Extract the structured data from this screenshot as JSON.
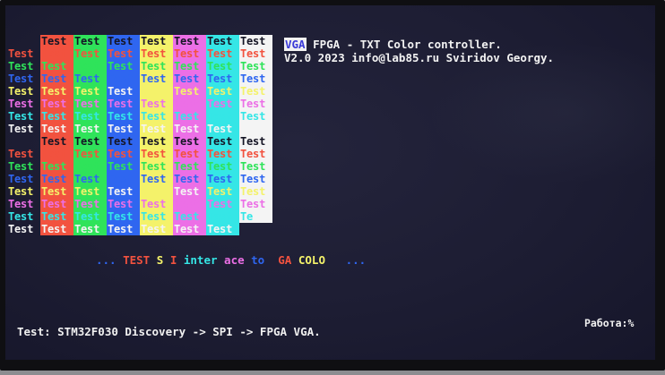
{
  "palette": {
    "red": "#f2523f",
    "green": "#2fe35a",
    "blue": "#2f66f0",
    "yellow": "#f4f26a",
    "magenta": "#ec6fe6",
    "cyan": "#35e6e6",
    "white": "#f4f4f4",
    "black": "#151525"
  },
  "grid": {
    "rows": [
      [
        {
          "text": "",
          "bg": "",
          "fg": ""
        },
        {
          "text": "Test",
          "bg": "red",
          "fg": "black"
        },
        {
          "text": "Test",
          "bg": "green",
          "fg": "black"
        },
        {
          "text": "Test",
          "bg": "blue",
          "fg": "black"
        },
        {
          "text": "Test",
          "bg": "yellow",
          "fg": "black"
        },
        {
          "text": "Test",
          "bg": "magenta",
          "fg": "black"
        },
        {
          "text": "Test",
          "bg": "cyan",
          "fg": "black"
        },
        {
          "text": "Test",
          "bg": "white",
          "fg": "black"
        }
      ],
      [
        {
          "text": "Test",
          "bg": "",
          "fg": "red"
        },
        {
          "text": "Test",
          "bg": "red",
          "fg": "red"
        },
        {
          "text": "Test",
          "bg": "green",
          "fg": "red"
        },
        {
          "text": "Test",
          "bg": "blue",
          "fg": "red"
        },
        {
          "text": "Test",
          "bg": "yellow",
          "fg": "red"
        },
        {
          "text": "Test",
          "bg": "magenta",
          "fg": "red"
        },
        {
          "text": "Test",
          "bg": "cyan",
          "fg": "red"
        },
        {
          "text": "Test",
          "bg": "white",
          "fg": "red"
        }
      ],
      [
        {
          "text": "Test",
          "bg": "",
          "fg": "green"
        },
        {
          "text": "Test",
          "bg": "red",
          "fg": "green"
        },
        {
          "text": "Test",
          "bg": "green",
          "fg": "green"
        },
        {
          "text": "Test",
          "bg": "blue",
          "fg": "green"
        },
        {
          "text": "Test",
          "bg": "yellow",
          "fg": "green"
        },
        {
          "text": "Test",
          "bg": "magenta",
          "fg": "green"
        },
        {
          "text": "Test",
          "bg": "cyan",
          "fg": "green"
        },
        {
          "text": "Test",
          "bg": "white",
          "fg": "green"
        }
      ],
      [
        {
          "text": "Test",
          "bg": "",
          "fg": "blue"
        },
        {
          "text": "Test",
          "bg": "red",
          "fg": "blue"
        },
        {
          "text": "Test",
          "bg": "green",
          "fg": "blue"
        },
        {
          "text": "Test",
          "bg": "blue",
          "fg": "blue"
        },
        {
          "text": "Test",
          "bg": "yellow",
          "fg": "blue"
        },
        {
          "text": "Test",
          "bg": "magenta",
          "fg": "blue"
        },
        {
          "text": "Test",
          "bg": "cyan",
          "fg": "blue"
        },
        {
          "text": "Test",
          "bg": "white",
          "fg": "blue"
        }
      ],
      [
        {
          "text": "Test",
          "bg": "",
          "fg": "yellow"
        },
        {
          "text": "Test",
          "bg": "red",
          "fg": "yellow"
        },
        {
          "text": "Test",
          "bg": "green",
          "fg": "yellow"
        },
        {
          "text": "Test",
          "bg": "blue",
          "fg": "white"
        },
        {
          "text": "Test",
          "bg": "yellow",
          "fg": "yellow"
        },
        {
          "text": "Test",
          "bg": "magenta",
          "fg": "yellow"
        },
        {
          "text": "Test",
          "bg": "cyan",
          "fg": "yellow"
        },
        {
          "text": "Test",
          "bg": "white",
          "fg": "yellow"
        }
      ],
      [
        {
          "text": "Test",
          "bg": "",
          "fg": "magenta"
        },
        {
          "text": "Test",
          "bg": "red",
          "fg": "magenta"
        },
        {
          "text": "Test",
          "bg": "green",
          "fg": "magenta"
        },
        {
          "text": "Test",
          "bg": "blue",
          "fg": "magenta"
        },
        {
          "text": "Test",
          "bg": "yellow",
          "fg": "magenta"
        },
        {
          "text": "Test",
          "bg": "magenta",
          "fg": "magenta"
        },
        {
          "text": "Test",
          "bg": "cyan",
          "fg": "magenta"
        },
        {
          "text": "Test",
          "bg": "white",
          "fg": "magenta"
        }
      ],
      [
        {
          "text": "Test",
          "bg": "",
          "fg": "cyan"
        },
        {
          "text": "Test",
          "bg": "red",
          "fg": "cyan"
        },
        {
          "text": "Test",
          "bg": "green",
          "fg": "cyan"
        },
        {
          "text": "Test",
          "bg": "blue",
          "fg": "cyan"
        },
        {
          "text": "Test",
          "bg": "yellow",
          "fg": "cyan"
        },
        {
          "text": "Test",
          "bg": "magenta",
          "fg": "cyan"
        },
        {
          "text": "Test",
          "bg": "cyan",
          "fg": "cyan"
        },
        {
          "text": "Test",
          "bg": "white",
          "fg": "cyan"
        }
      ],
      [
        {
          "text": "Test",
          "bg": "",
          "fg": "white"
        },
        {
          "text": "Test",
          "bg": "red",
          "fg": "white"
        },
        {
          "text": "Test",
          "bg": "green",
          "fg": "white"
        },
        {
          "text": "Test",
          "bg": "blue",
          "fg": "white"
        },
        {
          "text": "Test",
          "bg": "yellow",
          "fg": "white"
        },
        {
          "text": "Test",
          "bg": "magenta",
          "fg": "white"
        },
        {
          "text": "Test",
          "bg": "cyan",
          "fg": "white"
        },
        {
          "text": "Test",
          "bg": "white",
          "fg": "white"
        }
      ],
      [
        {
          "text": "",
          "bg": "",
          "fg": ""
        },
        {
          "text": "Test",
          "bg": "red",
          "fg": "black"
        },
        {
          "text": "Test",
          "bg": "green",
          "fg": "black"
        },
        {
          "text": "Test",
          "bg": "blue",
          "fg": "black"
        },
        {
          "text": "Test",
          "bg": "yellow",
          "fg": "black"
        },
        {
          "text": "Test",
          "bg": "magenta",
          "fg": "black"
        },
        {
          "text": "Test",
          "bg": "cyan",
          "fg": "black"
        },
        {
          "text": "Test",
          "bg": "white",
          "fg": "black"
        }
      ],
      [
        {
          "text": "Test",
          "bg": "",
          "fg": "red"
        },
        {
          "text": "Test",
          "bg": "red",
          "fg": "red"
        },
        {
          "text": "Test",
          "bg": "green",
          "fg": "red"
        },
        {
          "text": "Test",
          "bg": "blue",
          "fg": "red"
        },
        {
          "text": "Test",
          "bg": "yellow",
          "fg": "red"
        },
        {
          "text": "Test",
          "bg": "magenta",
          "fg": "red"
        },
        {
          "text": "Test",
          "bg": "cyan",
          "fg": "red"
        },
        {
          "text": "Test",
          "bg": "white",
          "fg": "red"
        }
      ],
      [
        {
          "text": "Test",
          "bg": "",
          "fg": "green"
        },
        {
          "text": "Test",
          "bg": "red",
          "fg": "green"
        },
        {
          "text": "Test",
          "bg": "green",
          "fg": "green"
        },
        {
          "text": "Test",
          "bg": "blue",
          "fg": "green"
        },
        {
          "text": "Test",
          "bg": "yellow",
          "fg": "green"
        },
        {
          "text": "Test",
          "bg": "magenta",
          "fg": "green"
        },
        {
          "text": "Test",
          "bg": "cyan",
          "fg": "green"
        },
        {
          "text": "Test",
          "bg": "white",
          "fg": "green"
        }
      ],
      [
        {
          "text": "Test",
          "bg": "",
          "fg": "blue"
        },
        {
          "text": "Test",
          "bg": "red",
          "fg": "blue"
        },
        {
          "text": "Test",
          "bg": "green",
          "fg": "blue"
        },
        {
          "text": "Test",
          "bg": "blue",
          "fg": "blue"
        },
        {
          "text": "Test",
          "bg": "yellow",
          "fg": "blue"
        },
        {
          "text": "Test",
          "bg": "magenta",
          "fg": "blue"
        },
        {
          "text": "Test",
          "bg": "cyan",
          "fg": "blue"
        },
        {
          "text": "Test",
          "bg": "white",
          "fg": "blue"
        }
      ],
      [
        {
          "text": "Test",
          "bg": "",
          "fg": "yellow"
        },
        {
          "text": "Test",
          "bg": "red",
          "fg": "yellow"
        },
        {
          "text": "Test",
          "bg": "green",
          "fg": "yellow"
        },
        {
          "text": "Test",
          "bg": "blue",
          "fg": "white"
        },
        {
          "text": "Test",
          "bg": "yellow",
          "fg": "yellow"
        },
        {
          "text": "Test",
          "bg": "magenta",
          "fg": "white"
        },
        {
          "text": "Test",
          "bg": "cyan",
          "fg": "yellow"
        },
        {
          "text": "Test",
          "bg": "white",
          "fg": "yellow"
        }
      ],
      [
        {
          "text": "Test",
          "bg": "",
          "fg": "magenta"
        },
        {
          "text": "Test",
          "bg": "red",
          "fg": "magenta"
        },
        {
          "text": "Test",
          "bg": "green",
          "fg": "magenta"
        },
        {
          "text": "Test",
          "bg": "blue",
          "fg": "magenta"
        },
        {
          "text": "Test",
          "bg": "yellow",
          "fg": "magenta"
        },
        {
          "text": "Test",
          "bg": "magenta",
          "fg": "magenta"
        },
        {
          "text": "Test",
          "bg": "cyan",
          "fg": "magenta"
        },
        {
          "text": "Test",
          "bg": "white",
          "fg": "magenta"
        }
      ],
      [
        {
          "text": "Test",
          "bg": "",
          "fg": "cyan"
        },
        {
          "text": "Test",
          "bg": "red",
          "fg": "cyan"
        },
        {
          "text": "Test",
          "bg": "green",
          "fg": "cyan"
        },
        {
          "text": "Test",
          "bg": "blue",
          "fg": "cyan"
        },
        {
          "text": "Test",
          "bg": "yellow",
          "fg": "cyan"
        },
        {
          "text": "Test",
          "bg": "magenta",
          "fg": "cyan"
        },
        {
          "text": "Test",
          "bg": "cyan",
          "fg": "cyan"
        },
        {
          "text": "Te",
          "bg": "white",
          "fg": "cyan"
        }
      ],
      [
        {
          "text": "Test",
          "bg": "",
          "fg": "white"
        },
        {
          "text": "Test",
          "bg": "red",
          "fg": "white"
        },
        {
          "text": "Test",
          "bg": "green",
          "fg": "white"
        },
        {
          "text": "Test",
          "bg": "blue",
          "fg": "white"
        },
        {
          "text": "Test",
          "bg": "yellow",
          "fg": "white"
        },
        {
          "text": "Test",
          "bg": "magenta",
          "fg": "white"
        },
        {
          "text": "Test",
          "bg": "cyan",
          "fg": "white"
        },
        {
          "text": "",
          "bg": "",
          "fg": ""
        }
      ]
    ]
  },
  "header": {
    "line1_badge": "VGA",
    "line1_rest": " FPGA - TXT Color controller.",
    "line2": "V2.0 2023 info@lab85.ru Sviridov Georgy."
  },
  "banner": {
    "segments": [
      {
        "text": "... ",
        "color": "blue"
      },
      {
        "text": "TEST",
        "color": "red"
      },
      {
        "text": " ",
        "color": "white"
      },
      {
        "text": "S",
        "color": "yellow"
      },
      {
        "text": " ",
        "color": "white"
      },
      {
        "text": "I",
        "color": "red"
      },
      {
        "text": " ",
        "color": "white"
      },
      {
        "text": "inter",
        "color": "cyan"
      },
      {
        "text": " ",
        "color": "white"
      },
      {
        "text": "ace",
        "color": "magenta"
      },
      {
        "text": " ",
        "color": "white"
      },
      {
        "text": "to",
        "color": "blue"
      },
      {
        "text": "  ",
        "color": "white"
      },
      {
        "text": "GA",
        "color": "red"
      },
      {
        "text": " ",
        "color": "white"
      },
      {
        "text": "COLO",
        "color": "yellow"
      },
      {
        "text": "   ",
        "color": "white"
      },
      {
        "text": "...",
        "color": "blue"
      }
    ]
  },
  "status": {
    "line": "Test: STM32F030 Discovery -> SPI -> FPGA VGA.",
    "work": "Работа:%"
  }
}
